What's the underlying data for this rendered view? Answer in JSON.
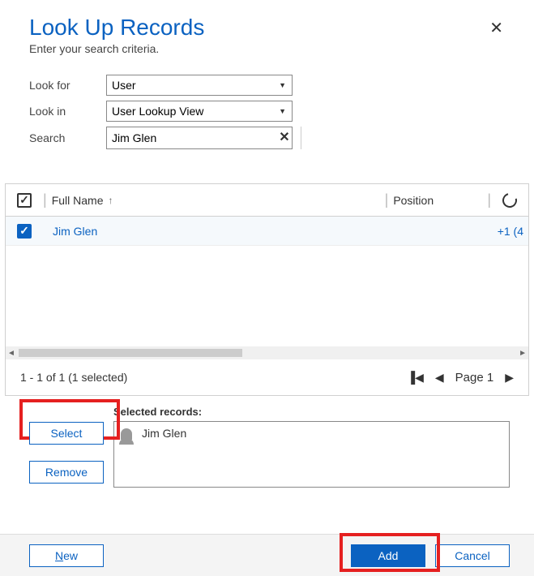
{
  "dialog": {
    "title": "Look Up Records",
    "subtitle": "Enter your search criteria."
  },
  "form": {
    "lookfor_label": "Look for",
    "lookfor_value": "User",
    "lookin_label": "Look in",
    "lookin_value": "User Lookup View",
    "search_label": "Search",
    "search_value": "Jim Glen"
  },
  "grid": {
    "col_fullname": "Full Name",
    "col_position": "Position",
    "rows": [
      {
        "name": "Jim Glen",
        "position": "",
        "phone": "+1 (4"
      }
    ]
  },
  "pager": {
    "summary": "1 - 1 of 1 (1 selected)",
    "page_label": "Page 1"
  },
  "selected": {
    "label": "Selected records:",
    "items": [
      "Jim Glen"
    ],
    "select_btn": "Select",
    "remove_btn": "Remove"
  },
  "footer": {
    "new_btn": "New",
    "add_btn": "Add",
    "cancel_btn": "Cancel"
  }
}
